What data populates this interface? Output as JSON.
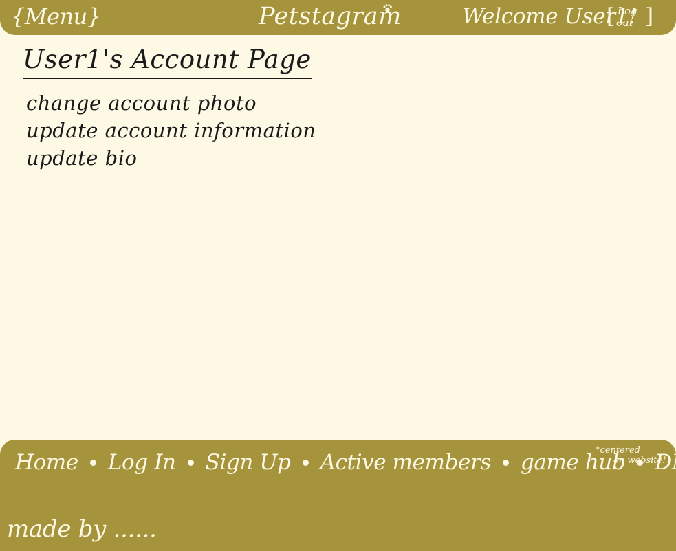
{
  "header": {
    "menu_label": "{Menu}",
    "brand": "Petstagram",
    "welcome": "Welcome User1!",
    "logout_line1": "Log",
    "logout_line2": "out",
    "logout_open": "[",
    "logout_close": "]"
  },
  "main": {
    "title": "User1's Account Page",
    "options": [
      "change account photo",
      "update account information",
      "update bio"
    ]
  },
  "footer": {
    "nav": [
      "Home",
      "Log In",
      "Sign Up",
      "Active members",
      "game hub",
      "DM's"
    ],
    "note_line1": "*centered",
    "note_line2": "on website!",
    "made_by": "made by ......"
  },
  "colors": {
    "background": "#fdf9e5",
    "bar": "#a5943c",
    "bar_text": "#fdf9e5",
    "text": "#1a1a1a"
  },
  "icons": [
    "paw-icon",
    "nav-separator-dot"
  ]
}
